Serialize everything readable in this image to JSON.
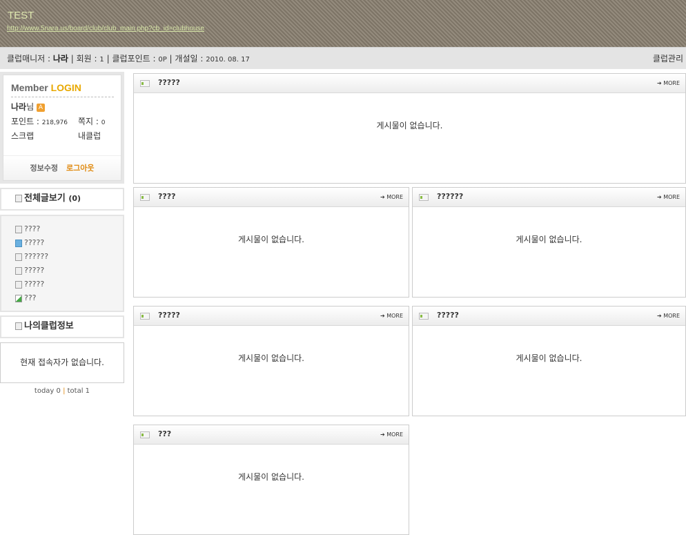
{
  "header": {
    "title": "TEST",
    "url": "http://www.5nara.us/board/club/club_main.php?cb_id=clubhouse"
  },
  "info": {
    "manager_label": "클럽매니저 : ",
    "manager": "나라",
    "members_label": " | 회원 : ",
    "members": "1",
    "points_label": " | 클럽포인트 : ",
    "points": "0P",
    "date_label": " | 개설일 : ",
    "date": "2010. 08. 17",
    "manage": "클럽관리"
  },
  "login": {
    "title_a": "Member ",
    "title_b": "LOGIN",
    "user": "나라",
    "suffix": "님",
    "badge": "A",
    "points_label": "포인트 : ",
    "points": "218,976",
    "memo_label": "쪽지 : ",
    "memo": "0",
    "scrap": "스크랩",
    "myclub": "내클럽",
    "edit": "정보수정",
    "logout": "로그아웃"
  },
  "all_posts": {
    "label": "전체글보기",
    "count": "(0)"
  },
  "menu": [
    "????",
    "?????",
    "??????",
    "?????",
    "?????",
    "???"
  ],
  "myclub": {
    "label": "나의클럽정보",
    "status": "현재 접속자가 없습니다."
  },
  "counter": {
    "today": "today 0",
    "sep": " | ",
    "total": "total 1"
  },
  "boards": [
    {
      "title": "?????",
      "more": "MORE",
      "empty": "게시물이 없습니다."
    },
    {
      "title": "????",
      "more": "MORE",
      "empty": "게시물이 없습니다."
    },
    {
      "title": "??????",
      "more": "MORE",
      "empty": "게시물이 없습니다."
    },
    {
      "title": "?????",
      "more": "MORE",
      "empty": "게시물이 없습니다."
    },
    {
      "title": "?????",
      "more": "MORE",
      "empty": "게시물이 없습니다."
    },
    {
      "title": "???",
      "more": "MORE",
      "empty": "게시물이 없습니다."
    }
  ]
}
